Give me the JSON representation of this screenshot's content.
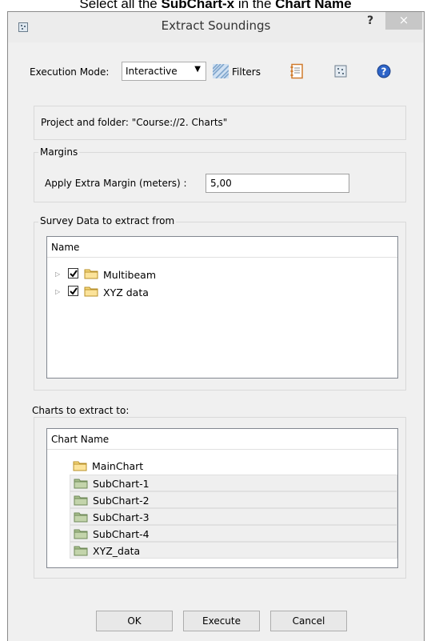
{
  "instruction": {
    "prefix": "Select all the ",
    "bold1": "SubChart-x",
    "middle": " in the ",
    "bold2": "Chart Name"
  },
  "dialog": {
    "title": "Extract Soundings",
    "help_label": "?",
    "close_label": "×"
  },
  "toolbar": {
    "execution_mode_label": "Execution Mode:",
    "execution_mode_value": "Interactive",
    "filters_label": "Filters"
  },
  "project": {
    "text": "Project and folder: \"Course://2. Charts\""
  },
  "margins": {
    "title": "Margins",
    "label": "Apply Extra Margin (meters) :",
    "value": "5,00"
  },
  "survey": {
    "title": "Survey Data to extract from",
    "column_header": "Name",
    "items": [
      {
        "label": "Multibeam",
        "checked": true
      },
      {
        "label": "XYZ data",
        "checked": true
      }
    ]
  },
  "charts": {
    "title": "Charts to extract to:",
    "column_header": "Chart Name",
    "items": [
      {
        "label": "MainChart",
        "color": "#f5d77a"
      },
      {
        "label": "SubChart-1",
        "color": "#a9c08e"
      },
      {
        "label": "SubChart-2",
        "color": "#a9c08e"
      },
      {
        "label": "SubChart-3",
        "color": "#a9c08e"
      },
      {
        "label": "SubChart-4",
        "color": "#a9c08e"
      },
      {
        "label": "XYZ_data",
        "color": "#a9c08e"
      }
    ]
  },
  "buttons": {
    "ok": "OK",
    "execute": "Execute",
    "cancel": "Cancel"
  }
}
